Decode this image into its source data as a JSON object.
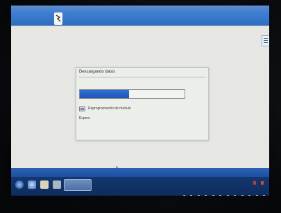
{
  "window": {
    "title": ""
  },
  "dialog": {
    "title": "Descargando datos",
    "progress": 0.47,
    "module_label": "Reprogramación de módulo",
    "status": "Espere"
  },
  "colors": {
    "accent": "#2f6fd6",
    "toolbar": "#3f7fd4",
    "taskbar": "#173d7a"
  },
  "icons": {
    "logo": "app-logo-icon",
    "menu": "hamburger-menu-icon",
    "module": "module-icon",
    "cursor": "mouse-cursor-icon"
  }
}
